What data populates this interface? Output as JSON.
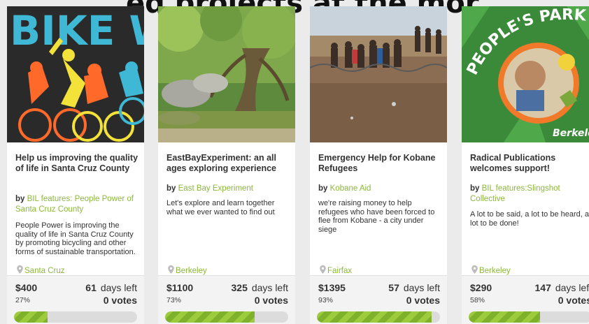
{
  "header": {
    "title": "ed projects at the mor"
  },
  "projects": [
    {
      "image": "bike-week-poster",
      "title": "Help us improving the quality of life in Santa Cruz County",
      "by": "by",
      "author": "BIL features: People Power of Santa Cruz County",
      "description": "People Power is improving the quality of life in Santa Cruz County by promoting bicycling and other forms of sustainable transportation.",
      "location": "Santa Cruz",
      "amount": "$400",
      "percent_label": "27%",
      "progress": 0.27,
      "days": "61",
      "days_label": "days left",
      "votes": "0 votes"
    },
    {
      "image": "forest-creek-photo",
      "title": "EastBayExperiment: an all ages exploring experience",
      "by": "by",
      "author": "East Bay Experiment",
      "description": "Let's explore and learn together what we ever wanted to find out",
      "location": "Berkeley",
      "amount": "$1100",
      "percent_label": "73%",
      "progress": 0.73,
      "days": "325",
      "days_label": "days left",
      "votes": "0 votes"
    },
    {
      "image": "refugees-photo",
      "title": "Emergency Help for Kobane Refugees",
      "by": "by",
      "author": "Kobane Aid",
      "description": "we're raising money to help refugees who have been forced to flee from Kobane - a city under siege",
      "location": "Fairfax",
      "amount": "$1395",
      "percent_label": "93%",
      "progress": 0.93,
      "days": "57",
      "days_label": "days left",
      "votes": "0 votes"
    },
    {
      "image": "peoples-park-book-cover",
      "title": "Radical Publications welcomes support!",
      "by": "by",
      "author": "BIL features:Slingshot Collective",
      "description": "A lot to be said, a lot to be heard, a lot to be done!",
      "location": "Berkeley",
      "amount": "$290",
      "percent_label": "58%",
      "progress": 0.58,
      "days": "147",
      "days_label": "days left",
      "votes": "0 votes"
    }
  ],
  "images": {
    "bike_text": "BIKE W",
    "park_text": "PEOPLE'S PARK",
    "park_city": "Berkeley"
  },
  "colors": {
    "accent": "#8cb83a",
    "progress_dark": "#7fb12a",
    "progress_light": "#9ccc3d"
  }
}
